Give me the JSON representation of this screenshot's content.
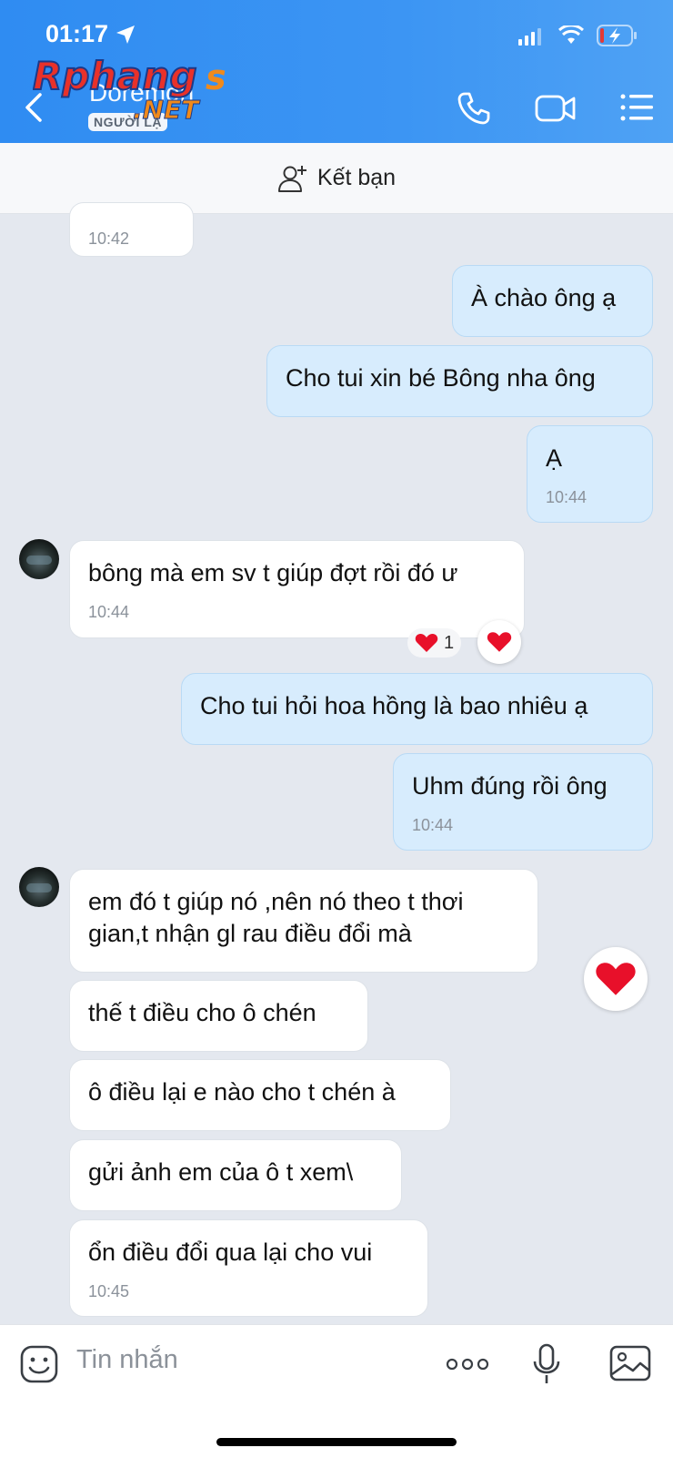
{
  "status_bar": {
    "time": "01:17"
  },
  "header": {
    "contact_name": "Doremon",
    "badge": "NGƯỜI LẠ",
    "watermark": "Rphangs.NET"
  },
  "friend_bar": {
    "label": "Kết bạn"
  },
  "messages": [
    {
      "dir": "in",
      "text": "",
      "time": "10:42"
    },
    {
      "dir": "out",
      "text": "À chào ông ạ",
      "time": ""
    },
    {
      "dir": "out",
      "text": "Cho tui xin bé Bông nha ông",
      "time": ""
    },
    {
      "dir": "out",
      "text": "Ạ",
      "time": "10:44"
    },
    {
      "dir": "in",
      "text": "bông mà em sv t giúp đợt rồi đó ư",
      "time": "10:44",
      "reaction_count": "1"
    },
    {
      "dir": "out",
      "text": "Cho tui hỏi hoa hồng là bao nhiêu ạ",
      "time": ""
    },
    {
      "dir": "out",
      "text": "Uhm đúng rồi ông",
      "time": "10:44"
    },
    {
      "dir": "in",
      "text": "em đó t giúp nó ,nên nó theo t thơi gian,t nhận gl rau điều đổi mà",
      "time": ""
    },
    {
      "dir": "in",
      "text": "thế t điều cho ô chén",
      "time": ""
    },
    {
      "dir": "in",
      "text": "ô điều lại e nào cho t chén à",
      "time": ""
    },
    {
      "dir": "in",
      "text": "gửi ảnh em của ô t xem\\",
      "time": ""
    },
    {
      "dir": "in",
      "text": "ổn điều đổi qua lại cho vui",
      "time": "10:45"
    }
  ],
  "input": {
    "placeholder": "Tin nhắn"
  },
  "colors": {
    "header": "#2f8cf2",
    "outgoing_bubble": "#d7ecfd",
    "incoming_bubble": "#ffffff",
    "background": "#e4e8ef",
    "heart": "#e8102a"
  }
}
